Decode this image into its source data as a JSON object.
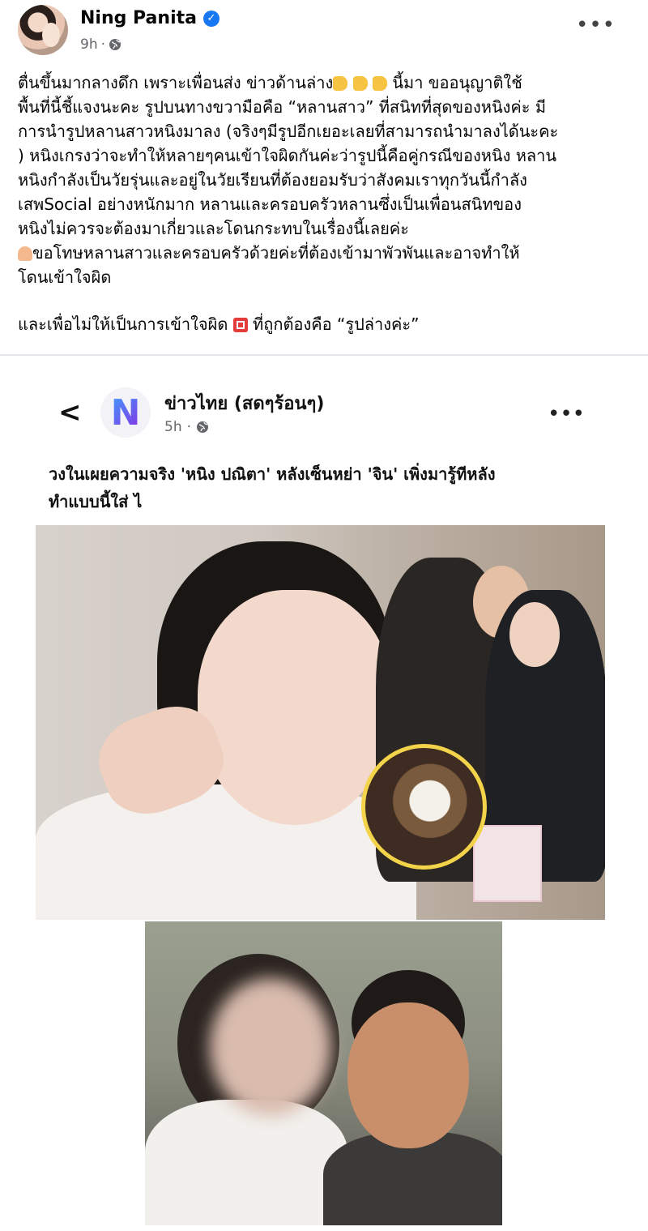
{
  "post": {
    "author": "Ning Panita",
    "time": "9h",
    "more_label": "•••",
    "text": {
      "p1_l1": "ตื่นขึ้นมากลางดึก เพราะเพื่อนส่ง ข่าวด้านล่าง",
      "p1_l1b": " นี้มา ขออนุญาติใช้",
      "p1_l2": "พื้นที่นี้ชี้แจงนะคะ รูปบนทางขวามือคือ “หลานสาว” ที่สนิทที่สุดของหนิงค่ะ มี",
      "p1_l3": "การนำรูปหลานสาวหนิงมาลง (จริงๆมีรูปอีกเยอะเลยที่สามารถนำมาลงได้นะคะ",
      "p1_l4": ") หนิงเกรงว่าจะทำให้หลายๆคนเข้าใจผิดกันค่ะว่ารูปนี้คือคู่กรณีของหนิง หลาน",
      "p1_l5": "หนิงกำลังเป็นวัยรุ่นและอยู่ในวัยเรียนที่ต้องยอมรับว่าสังคมเราทุกวันนี้กำลัง",
      "p1_l6": "เสพSocial อย่างหนักมาก  หลานและครอบครัวหลานซึ่งเป็นเพื่อนสนิทของ",
      "p1_l7": "หนิงไม่ควรจะต้องมาเกี่ยวและโดนกระทบในเรื่องนี้เลยค่ะ",
      "p1_l8": "ขอโทษหลานสาวและครอบครัวด้วยค่ะที่ต้องเข้ามาพัวพันและอาจทำให้",
      "p1_l9": "โดนเข้าใจผิด",
      "p2_a": "และเพื่อไม่ให้เป็นการเข้าใจผิด ",
      "p2_b": " ที่ถูกต้องคือ “รูปล่างค่ะ”"
    }
  },
  "shared": {
    "back_label": "<",
    "page_logo": "N",
    "page_name": "ข่าวไทย  (สดๆร้อนๆ)",
    "time": "5h",
    "more_label": "•••",
    "headline_l1": "วงในเผยความจริง 'หนิง ปณิตา' หลังเซ็นหย่า 'จิน' เพิ่งมารู้ทีหลัง",
    "headline_l2": "ทำแบบนี้ใส่ ไ"
  },
  "icons": {
    "verified": "verified-badge-icon",
    "globe": "globe-icon",
    "hand": "backhand-index-pointing-down-emoji",
    "pray": "folded-hands-emoji",
    "red": "red-square-emoji"
  },
  "colors": {
    "verified": "#1877f2",
    "meta": "#65676b",
    "divider": "#e4e6eb"
  }
}
